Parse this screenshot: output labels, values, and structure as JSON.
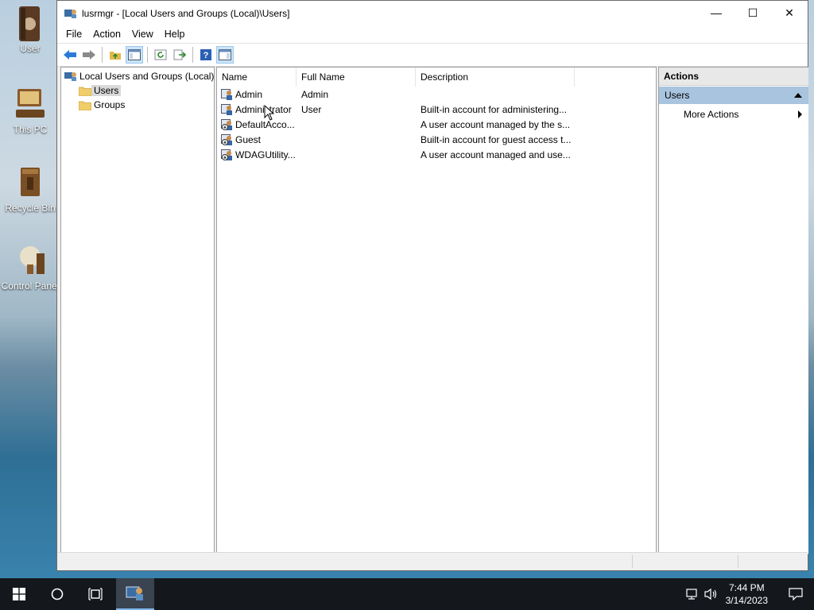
{
  "desktop": {
    "icons": [
      {
        "label": "User",
        "icon": "user-folder-icon"
      },
      {
        "label": "This PC",
        "icon": "computer-icon"
      },
      {
        "label": "Recycle Bin",
        "icon": "recycle-bin-icon"
      },
      {
        "label": "Control Panel",
        "icon": "control-panel-icon"
      }
    ]
  },
  "window": {
    "title": "lusrmgr - [Local Users and Groups (Local)\\Users]",
    "controls": {
      "minimize": "—",
      "maximize": "☐",
      "close": "✕"
    }
  },
  "menu": [
    "File",
    "Action",
    "View",
    "Help"
  ],
  "toolbar": [
    "back-icon",
    "forward-icon",
    "up-folder-icon",
    "show-hide-tree-icon",
    "refresh-icon",
    "export-list-icon",
    "help-icon",
    "show-hide-action-pane-icon"
  ],
  "tree": {
    "root": "Local Users and Groups (Local)",
    "children": [
      "Users",
      "Groups"
    ],
    "selected": "Users"
  },
  "list": {
    "columns": [
      "Name",
      "Full Name",
      "Description"
    ],
    "rows": [
      {
        "name": "Admin",
        "full_name": "Admin",
        "description": ""
      },
      {
        "name": "Administrator",
        "full_name": "User",
        "description": "Built-in account for administering..."
      },
      {
        "name": "DefaultAcco...",
        "full_name": "",
        "description": "A user account managed by the s..."
      },
      {
        "name": "Guest",
        "full_name": "",
        "description": "Built-in account for guest access t..."
      },
      {
        "name": "WDAGUtility...",
        "full_name": "",
        "description": "A user account managed and use..."
      }
    ]
  },
  "actions": {
    "header": "Actions",
    "section": "Users",
    "items": [
      "More Actions"
    ]
  },
  "taskbar": {
    "time": "7:44 PM",
    "date": "3/14/2023"
  },
  "colors": {
    "selection_gray": "#d9d9d9",
    "actions_band": "#a9c4de",
    "taskbar": "#14181d"
  }
}
